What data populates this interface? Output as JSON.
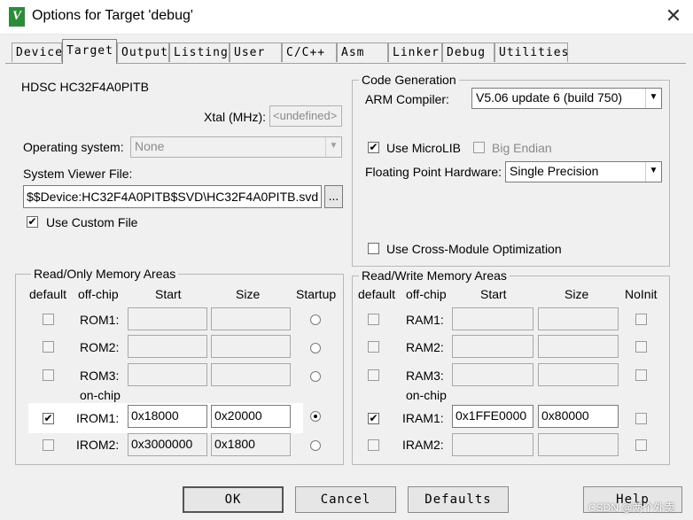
{
  "window": {
    "title": "Options for Target 'debug'",
    "app_icon_letter": "V"
  },
  "tabs": [
    {
      "label": "Device"
    },
    {
      "label": "Target"
    },
    {
      "label": "Output"
    },
    {
      "label": "Listing"
    },
    {
      "label": "User"
    },
    {
      "label": "C/C++"
    },
    {
      "label": "Asm"
    },
    {
      "label": "Linker"
    },
    {
      "label": "Debug"
    },
    {
      "label": "Utilities"
    }
  ],
  "active_tab": "Target",
  "device": {
    "name": "HDSC HC32F4A0PITB",
    "xtal_label": "Xtal (MHz):",
    "xtal_value": "<undefined>",
    "os_label": "Operating system:",
    "os_value": "None",
    "svd_label": "System Viewer File:",
    "svd_value": "$$Device:HC32F4A0PITB$SVD\\HC32F4A0PITB.svd",
    "browse_label": "...",
    "custom_file_label": "Use Custom File",
    "custom_file_checked": true
  },
  "codegen": {
    "title": "Code Generation",
    "compiler_label": "ARM Compiler:",
    "compiler_value": "V5.06 update 6 (build 750)",
    "microlib_label": "Use MicroLIB",
    "microlib_checked": true,
    "bigendian_label": "Big Endian",
    "bigendian_checked": false,
    "fph_label": "Floating Point Hardware:",
    "fph_value": "Single Precision",
    "cross_label": "Use Cross-Module Optimization",
    "cross_checked": false
  },
  "ro": {
    "title": "Read/Only Memory Areas",
    "headers": {
      "default": "default",
      "offchip": "off-chip",
      "start": "Start",
      "size": "Size",
      "startup": "Startup"
    },
    "onchip_label": "on-chip",
    "rows": [
      {
        "name": "ROM1:",
        "start": "",
        "size": "",
        "default": false,
        "startup": false
      },
      {
        "name": "ROM2:",
        "start": "",
        "size": "",
        "default": false,
        "startup": false
      },
      {
        "name": "ROM3:",
        "start": "",
        "size": "",
        "default": false,
        "startup": false
      },
      {
        "name": "IROM1:",
        "start": "0x18000",
        "size": "0x20000",
        "default": true,
        "startup": true
      },
      {
        "name": "IROM2:",
        "start": "0x3000000",
        "size": "0x1800",
        "default": false,
        "startup": false
      }
    ]
  },
  "rw": {
    "title": "Read/Write Memory Areas",
    "headers": {
      "default": "default",
      "offchip": "off-chip",
      "start": "Start",
      "size": "Size",
      "noinit": "NoInit"
    },
    "onchip_label": "on-chip",
    "rows": [
      {
        "name": "RAM1:",
        "start": "",
        "size": "",
        "default": false,
        "noinit": false
      },
      {
        "name": "RAM2:",
        "start": "",
        "size": "",
        "default": false,
        "noinit": false
      },
      {
        "name": "RAM3:",
        "start": "",
        "size": "",
        "default": false,
        "noinit": false
      },
      {
        "name": "IRAM1:",
        "start": "0x1FFE0000",
        "size": "0x80000",
        "default": true,
        "noinit": false
      },
      {
        "name": "IRAM2:",
        "start": "",
        "size": "",
        "default": false,
        "noinit": false
      }
    ]
  },
  "buttons": {
    "ok": "OK",
    "cancel": "Cancel",
    "defaults": "Defaults",
    "help": "Help"
  },
  "watermark": "CSDN @两个外卖",
  "icons": {
    "close": "close-icon",
    "dropdown": "chevron-down-icon",
    "check": "checkmark-icon"
  }
}
